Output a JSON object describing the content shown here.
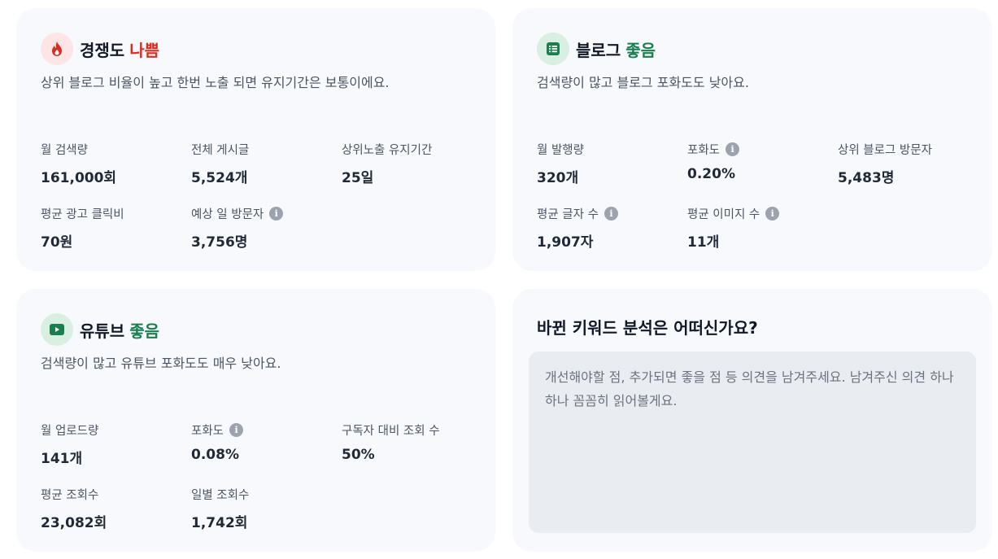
{
  "competition": {
    "title": "경쟁도",
    "status": "나쁨",
    "status_color": "#d92d20",
    "icon": "fire-icon",
    "icon_bg": "#fde5e5",
    "description": "상위 블로그 비율이 높고 한번 노출 되면 유지기간은 보통이에요.",
    "stats": [
      {
        "label": "월 검색량",
        "value": "161,000회"
      },
      {
        "label": "전체 게시글",
        "value": "5,524개"
      },
      {
        "label": "상위노출 유지기간",
        "value": "25일"
      },
      {
        "label": "평균 광고 클릭비",
        "value": "70원"
      },
      {
        "label": "예상 일 방문자",
        "value": "3,756명"
      }
    ]
  },
  "blog": {
    "title": "블로그",
    "status": "좋음",
    "status_color": "#1a7f4e",
    "icon": "list-icon",
    "icon_bg": "#d9efe2",
    "description": "검색량이 많고 블로그 포화도도 낮아요.",
    "stats": [
      {
        "label": "월 발행량",
        "value": "320개"
      },
      {
        "label": "포화도",
        "value": "0.20%"
      },
      {
        "label": "상위 블로그 방문자",
        "value": "5,483명"
      },
      {
        "label": "평균 글자 수",
        "value": "1,907자"
      },
      {
        "label": "평균 이미지 수",
        "value": "11개"
      }
    ]
  },
  "youtube": {
    "title": "유튜브",
    "status": "좋음",
    "status_color": "#1a7f4e",
    "icon": "play-icon",
    "icon_bg": "#d9efe2",
    "description": "검색량이 많고 유튜브 포화도도 매우 낮아요.",
    "stats": [
      {
        "label": "월 업로드량",
        "value": "141개"
      },
      {
        "label": "포화도",
        "value": "0.08%"
      },
      {
        "label": "구독자 대비 조회 수",
        "value": "50%"
      },
      {
        "label": "평균 조회수",
        "value": "23,082회"
      },
      {
        "label": "일별 조회수",
        "value": "1,742회"
      }
    ]
  },
  "feedback": {
    "title": "바뀐 키워드 분석은 어떠신가요?",
    "placeholder": "개선해야할 점, 추가되면 좋을 점 등 의견을 남겨주세요. 남겨주신 의견 하나하나 꼼꼼히 읽어볼게요."
  },
  "icons": {
    "info": "info-icon"
  }
}
